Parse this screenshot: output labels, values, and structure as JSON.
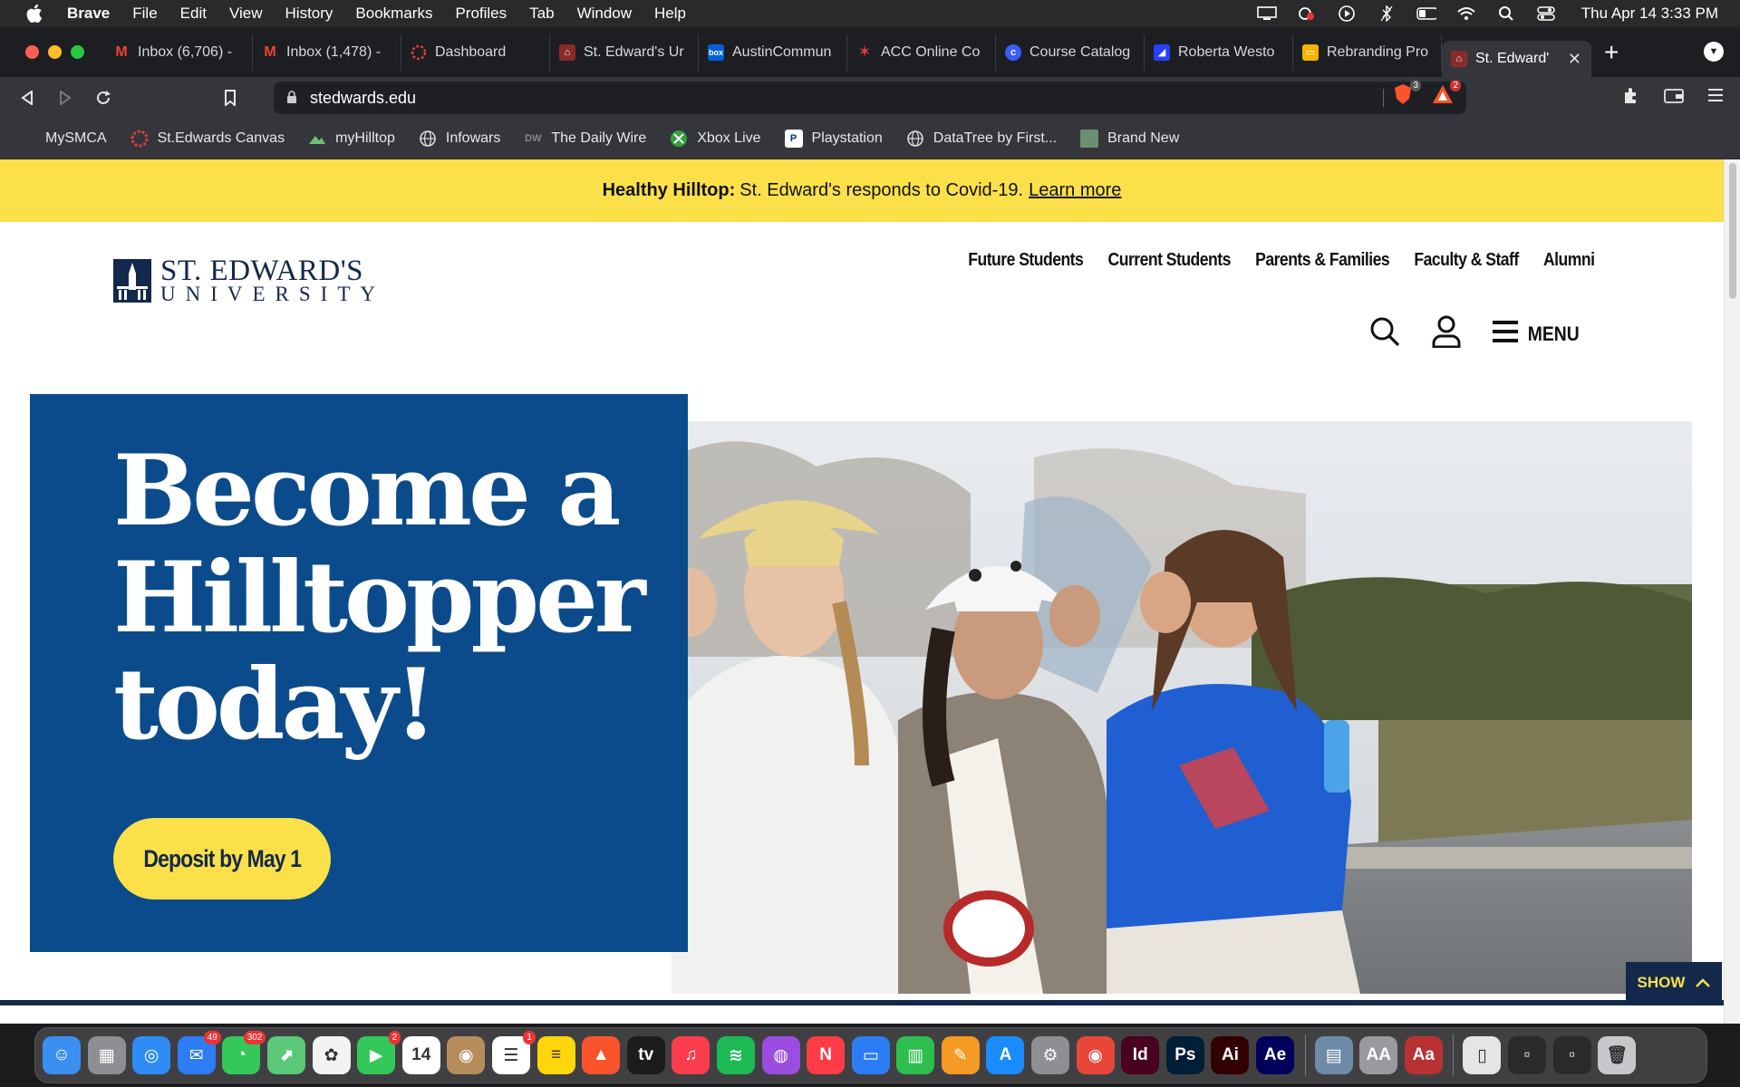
{
  "menubar": {
    "app": "Brave",
    "items": [
      "File",
      "Edit",
      "View",
      "History",
      "Bookmarks",
      "Profiles",
      "Tab",
      "Window",
      "Help"
    ],
    "clock": "Thu Apr 14  3:33 PM"
  },
  "tabs": [
    {
      "title": "Inbox (6,706) -",
      "icon": "gmail-icon",
      "color": "#ea4335"
    },
    {
      "title": "Inbox (1,478) -",
      "icon": "gmail-icon",
      "color": "#ea4335"
    },
    {
      "title": "Dashboard",
      "icon": "canvas-icon",
      "color": "#e13c3c"
    },
    {
      "title": "St. Edward's Ur",
      "icon": "stedwards-icon",
      "color": "#8a2b2b"
    },
    {
      "title": "AustinCommun",
      "icon": "box-icon",
      "color": "#0061d5"
    },
    {
      "title": "ACC Online Co",
      "icon": "acc-star-icon",
      "color": "#2d62d6"
    },
    {
      "title": "Course Catalog",
      "icon": "catalog-icon",
      "color": "#3d5afe"
    },
    {
      "title": "Roberta Westo",
      "icon": "site-icon",
      "color": "#2540ff"
    },
    {
      "title": "Rebranding Pro",
      "icon": "slides-icon",
      "color": "#f4b400"
    },
    {
      "title": "St. Edward'",
      "icon": "stedwards-icon",
      "color": "#8a2b2b"
    }
  ],
  "toolbar": {
    "url": "stedwards.edu",
    "brave_count": "3",
    "rewards_count": "2"
  },
  "bookmarks": [
    {
      "label": "MySMCA",
      "icon": ""
    },
    {
      "label": "St.Edwards Canvas",
      "icon": "canvas-icon"
    },
    {
      "label": "myHilltop",
      "icon": "hilltop-icon"
    },
    {
      "label": "Infowars",
      "icon": "globe-icon"
    },
    {
      "label": "The Daily Wire",
      "icon": "dw-icon"
    },
    {
      "label": "Xbox Live",
      "icon": "xbox-icon"
    },
    {
      "label": "Playstation",
      "icon": "playstation-icon"
    },
    {
      "label": "DataTree by First...",
      "icon": "globe-icon"
    },
    {
      "label": "Brand New",
      "icon": "brandnew-icon"
    }
  ],
  "banner": {
    "bold": "Healthy Hilltop:",
    "text": "St. Edward's responds to Covid-19.",
    "link": "Learn more"
  },
  "site": {
    "logo_line1": "ST. EDWARD'S",
    "logo_line2": "UNIVERSITY",
    "nav": [
      "Future Students",
      "Current Students",
      "Parents & Families",
      "Faculty & Staff",
      "Alumni"
    ],
    "menu_label": "MENU",
    "hero_title_lines": [
      "Become a",
      "Hilltopper",
      "today!"
    ],
    "cta": "Deposit by May 1",
    "show_label": "SHOW",
    "colors": {
      "navy": "#13294b",
      "blue": "#0b4b8b",
      "gold": "#fbe04a"
    }
  },
  "dock": [
    {
      "name": "finder-icon",
      "color": "#3b8ff0",
      "glyph": "☺"
    },
    {
      "name": "launchpad-icon",
      "color": "#8e8e93",
      "glyph": "▦"
    },
    {
      "name": "safari-icon",
      "color": "#2f8cf5",
      "glyph": "◎"
    },
    {
      "name": "mail-icon",
      "color": "#2e7cf6",
      "glyph": "✉",
      "badge": "49"
    },
    {
      "name": "messages-icon",
      "color": "#34c759",
      "glyph": "◔",
      "badge": "302"
    },
    {
      "name": "maps-icon",
      "color": "#5ac878",
      "glyph": "⬈"
    },
    {
      "name": "photos-icon",
      "color": "#f2f2f2",
      "glyph": "✿"
    },
    {
      "name": "facetime-icon",
      "color": "#34c759",
      "glyph": "▶",
      "badge": "2"
    },
    {
      "name": "calendar-icon",
      "color": "#ffffff",
      "glyph": "14"
    },
    {
      "name": "contacts-icon",
      "color": "#b58c5a",
      "glyph": "◉"
    },
    {
      "name": "reminders-icon",
      "color": "#ffffff",
      "glyph": "☰",
      "badge": "1"
    },
    {
      "name": "notes-icon",
      "color": "#ffd60a",
      "glyph": "≡"
    },
    {
      "name": "brave-icon",
      "color": "#fb542b",
      "glyph": "▲"
    },
    {
      "name": "appletv-icon",
      "color": "#1c1c1e",
      "glyph": "tv"
    },
    {
      "name": "music-icon",
      "color": "#fa3c4c",
      "glyph": "♫"
    },
    {
      "name": "spotify-icon",
      "color": "#1db954",
      "glyph": "≋"
    },
    {
      "name": "podcasts-icon",
      "color": "#9b4de0",
      "glyph": "◍"
    },
    {
      "name": "news-icon",
      "color": "#ff3b45",
      "glyph": "N"
    },
    {
      "name": "keynote-icon",
      "color": "#2b7df3",
      "glyph": "▭"
    },
    {
      "name": "numbers-icon",
      "color": "#2dbe4e",
      "glyph": "▥"
    },
    {
      "name": "pages-icon",
      "color": "#f59a23",
      "glyph": "✎"
    },
    {
      "name": "appstore-icon",
      "color": "#1a8cff",
      "glyph": "A"
    },
    {
      "name": "system-preferences-icon",
      "color": "#8e8e93",
      "glyph": "⚙"
    },
    {
      "name": "chrome-icon",
      "color": "#e9463a",
      "glyph": "◉"
    },
    {
      "name": "indesign-icon",
      "color": "#49021f",
      "glyph": "Id"
    },
    {
      "name": "photoshop-icon",
      "color": "#001e36",
      "glyph": "Ps"
    },
    {
      "name": "illustrator-icon",
      "color": "#330000",
      "glyph": "Ai"
    },
    {
      "name": "aftereffects-icon",
      "color": "#00005b",
      "glyph": "Ae"
    },
    {
      "name": "preview-icon",
      "color": "#6e8aa8",
      "glyph": "▤"
    },
    {
      "name": "fontbook-icon",
      "color": "#9a9a9e",
      "glyph": "AA"
    },
    {
      "name": "dictionary-icon",
      "color": "#b83232",
      "glyph": "Aa"
    },
    {
      "name": "document-icon",
      "color": "#e5e5e5",
      "glyph": "▯"
    },
    {
      "name": "screenshot-icon",
      "color": "#2a2a2c",
      "glyph": "▫"
    },
    {
      "name": "brave-window-icon",
      "color": "#2a2a2c",
      "glyph": "▫"
    },
    {
      "name": "trash-icon",
      "color": "#c7c7cc",
      "glyph": "🗑"
    }
  ]
}
